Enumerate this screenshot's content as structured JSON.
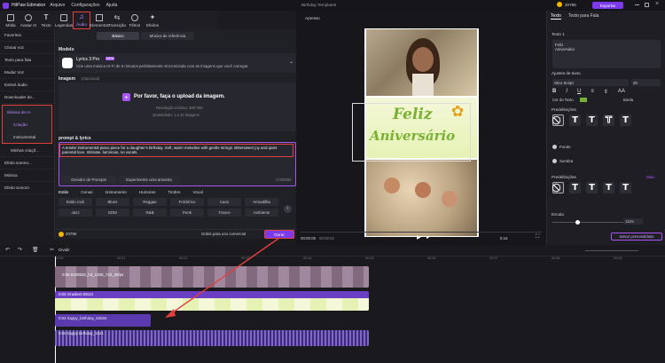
{
  "app": {
    "name": "HitPaw Edimakor",
    "menus": [
      "Arquivo",
      "Configurações",
      "Ajuda"
    ],
    "window_title": "Birthday Template6",
    "credits": "20786",
    "export_label": "Exportar"
  },
  "toolbar": {
    "tabs": [
      "Mídia",
      "Avatar AI",
      "Texto",
      "Legendas",
      "Áudio",
      "Elementos",
      "Transição",
      "Filtros",
      "Efeitos"
    ]
  },
  "sidebar": {
    "items": [
      "Favoritos",
      "Clonar voz",
      "Texto para fala",
      "Mudar Voz",
      "Extrair áudio",
      "Downloader de...",
      "Música de IA",
      "Criação",
      "Instrumental",
      "Minhas criaçõ...",
      "Efeito sonoro...",
      "Música",
      "Efeito Sonoro"
    ]
  },
  "panel": {
    "tab_basic": "Básico",
    "tab_ref": "Música de referência",
    "model_title": "Modelo",
    "model_name": "Lyrics 3 Pro",
    "model_badge": "NEW",
    "model_desc": "Crie uma música Hi-Fi de 5 minutos perfeitamente sincronizada com as imagens que você carregar.",
    "image_title": "Imagem",
    "image_optional": "(Opcional)",
    "upload_label": "Por favor, faça o upload da imagem.",
    "resolution": "Resolução mínima: 300*300",
    "quantity": "Quantidade: 1 a 10 imagens",
    "prompt_title": "prompt & lyrics",
    "prompt_text": "A tender instrumental piano piece for a daughter's birthday. Soft, warm melodies with gentle strings. Bittersweet joy and quiet parental love. Intimate, luminous, no vocals.",
    "prompt_gen": "Gerador de Prompts",
    "try_sample": "Experimente uma amostra",
    "char_count": "173/3000",
    "style_tabs": [
      "Estilo",
      "Cenas",
      "Instrumento",
      "Humores",
      "Timbre",
      "Vocal"
    ],
    "styles": [
      [
        "Estilo rock",
        "Blues",
        "Reggae",
        "Folclórico",
        "Caos",
        "Armadilha"
      ],
      [
        "Jazz",
        "EDM",
        "R&B",
        "Punk",
        "Trance",
        "Ambiente"
      ]
    ],
    "credits": "20786",
    "free_note": "Grátis para uso comercial",
    "generate": "Gerar"
  },
  "preview": {
    "label": "Apresso",
    "felix": "Feliz",
    "aniversario": "Aniversário",
    "time_current": "00:00:00",
    "time_total": "00:00:51",
    "speed": "5:16"
  },
  "right": {
    "tab_text": "Texto",
    "tab_tts": "Texto para Fala",
    "section_text": "Texto 1",
    "text_value": "Feliz\nAniversário",
    "adjust": "Ajustes de texto",
    "font": "Oleo Script",
    "size": "30",
    "color_label": "Cor do Texto",
    "border_label": "Borda",
    "presets": "Predefinições",
    "fill": "Fundo",
    "shadow": "Sombra",
    "presets2": "Predefinições",
    "more": "Mais",
    "scale": "Escala",
    "scale_value": "111%",
    "save": "Salvar personalidade"
  },
  "timeline": {
    "split": "Dividir",
    "tracks": [
      "0:05 8100934_hd_1280_720_25fps",
      "0:05 Gradient BG42",
      "0:04 happy_birthday_94534",
      "0:05 happy birthday_1021"
    ],
    "ruler": [
      "00:00",
      "00:01",
      "00:02",
      "00:03",
      "00:04",
      "00:05",
      "00:06",
      "00:07",
      "00:08",
      "00:09"
    ]
  }
}
